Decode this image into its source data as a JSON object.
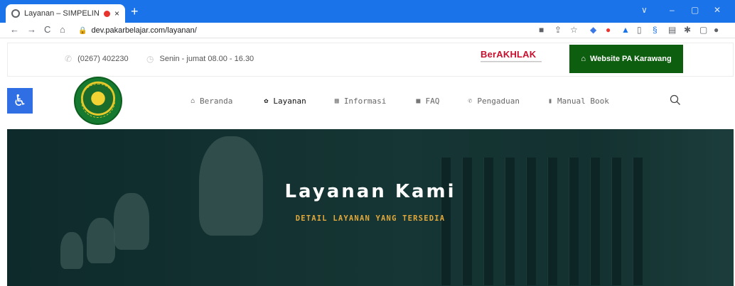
{
  "browser": {
    "tab_title": "Layanan – SIMPELIN – Peng",
    "tab_close": "×",
    "new_tab": "+",
    "url": "dev.pakarbelajar.com/layanan/",
    "back": "←",
    "forward": "→",
    "reload": "C",
    "home": "⌂",
    "window_controls": [
      "∨",
      "–",
      "▢",
      "✕"
    ]
  },
  "topbar": {
    "phone": "(0267) 402230",
    "hours": "Senin - jumat 08.00 - 16.30",
    "berakhlak": "BerAKHLAK",
    "website_button": "Website PA Karawang"
  },
  "nav": {
    "items": [
      {
        "label": "Beranda",
        "icon": "home-icon",
        "glyph": "⌂",
        "active": false
      },
      {
        "label": "Layanan",
        "icon": "gear-icon",
        "glyph": "✿",
        "active": true
      },
      {
        "label": "Informasi",
        "icon": "list-icon",
        "glyph": "▦",
        "active": false
      },
      {
        "label": "FAQ",
        "icon": "chat-icon",
        "glyph": "■",
        "active": false
      },
      {
        "label": "Pengaduan",
        "icon": "megaphone-icon",
        "glyph": "✆",
        "active": false
      },
      {
        "label": "Manual Book",
        "icon": "book-icon",
        "glyph": "▮",
        "active": false
      }
    ]
  },
  "hero": {
    "title": "Layanan Kami",
    "subtitle": "DETAIL LAYANAN YANG TERSEDIA"
  },
  "colors": {
    "chrome_blue": "#1a73e8",
    "brand_green": "#0e5e0f",
    "accent_orange": "#e1a83c",
    "access_blue": "#2f6fe3"
  }
}
